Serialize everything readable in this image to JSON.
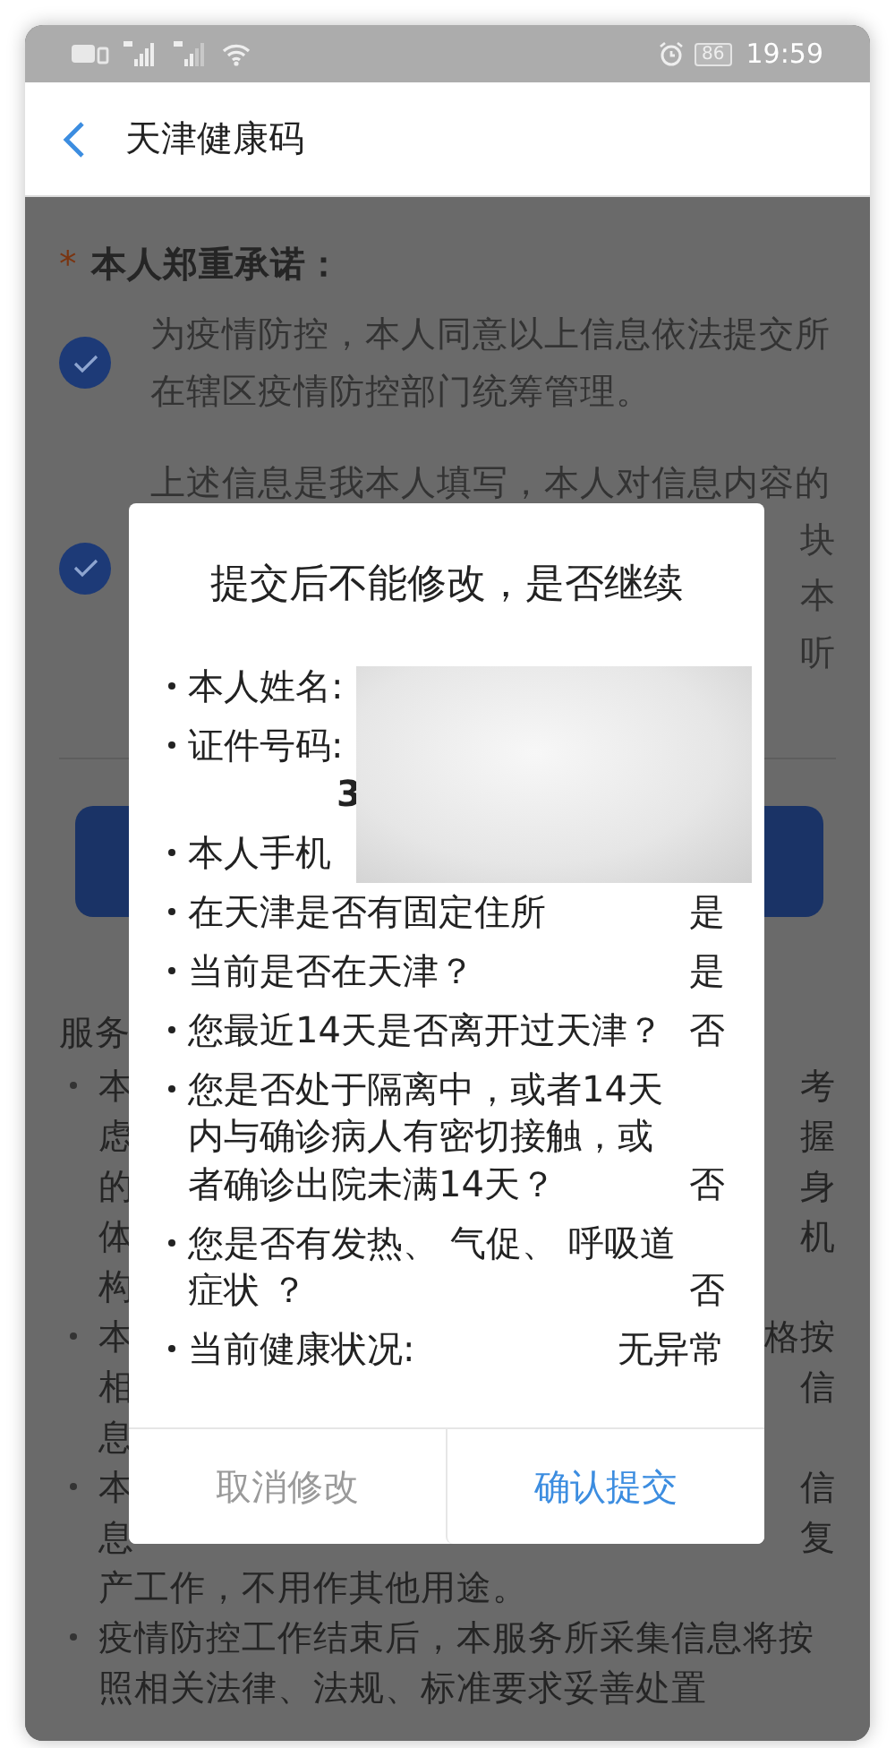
{
  "status_bar": {
    "battery": "86",
    "time": "19:59"
  },
  "header": {
    "title": "天津健康码"
  },
  "pledge": {
    "required_mark": "*",
    "label": "本人郑重承诺：",
    "items": [
      {
        "checked": true,
        "lines": [
          {
            "left": "为疫情防控，本人同意以上信息依法提交所"
          },
          {
            "left": "在辖区疫情防控部门统筹管理。"
          }
        ]
      },
      {
        "checked": true,
        "lines": [
          {
            "left": "上述信息是我本人填写，本人对信息内容的"
          },
          {
            "right": "块"
          },
          {
            "right": "本"
          },
          {
            "right": "听"
          }
        ]
      }
    ]
  },
  "services": {
    "heading": "服务",
    "items": [
      {
        "lines": [
          {
            "left": "本",
            "right": "考"
          },
          {
            "left": "虑",
            "right": "握"
          },
          {
            "left": "的",
            "right": "身"
          },
          {
            "left": "体",
            "right": "机"
          },
          {
            "left": "构"
          }
        ]
      },
      {
        "lines": [
          {
            "left": "本",
            "right": "格按"
          },
          {
            "left": "相",
            "right": "信"
          },
          {
            "left": "息"
          }
        ]
      },
      {
        "lines": [
          {
            "left": "本",
            "right": "信"
          },
          {
            "left": "息",
            "right": "复"
          },
          {
            "left": "产工作，不用作其他用途。"
          }
        ]
      },
      {
        "lines": [
          {
            "left": "疫情防控工作结束后，本服务所采集信息将按"
          },
          {
            "left": "照相关法律、法规、标准要求妥善处置"
          }
        ]
      }
    ]
  },
  "dialog": {
    "title": "提交后不能修改，是否继续",
    "items": [
      {
        "label": "本人姓名:"
      },
      {
        "label": "证件号码:",
        "value_line": "3"
      },
      {
        "label": "本人手机"
      },
      {
        "label": "在天津是否有固定住所",
        "answer": "是"
      },
      {
        "label": "当前是否在天津？",
        "answer": "是"
      },
      {
        "label": "您最近14天是否离开过天津？",
        "answer": "否"
      },
      {
        "label": "您是否处于隔离中，或者14天内与确诊病人有密切接触，或者确诊出院未满14天？",
        "answer": "否"
      },
      {
        "label": "您是否有发热、 气促、 呼吸道症状 ？",
        "answer": "否"
      },
      {
        "label": "当前健康状况:",
        "answer": "无异常"
      }
    ],
    "buttons": [
      {
        "label": "取消修改",
        "kind": "cancel"
      },
      {
        "label": "确认提交",
        "kind": "confirm"
      }
    ]
  }
}
